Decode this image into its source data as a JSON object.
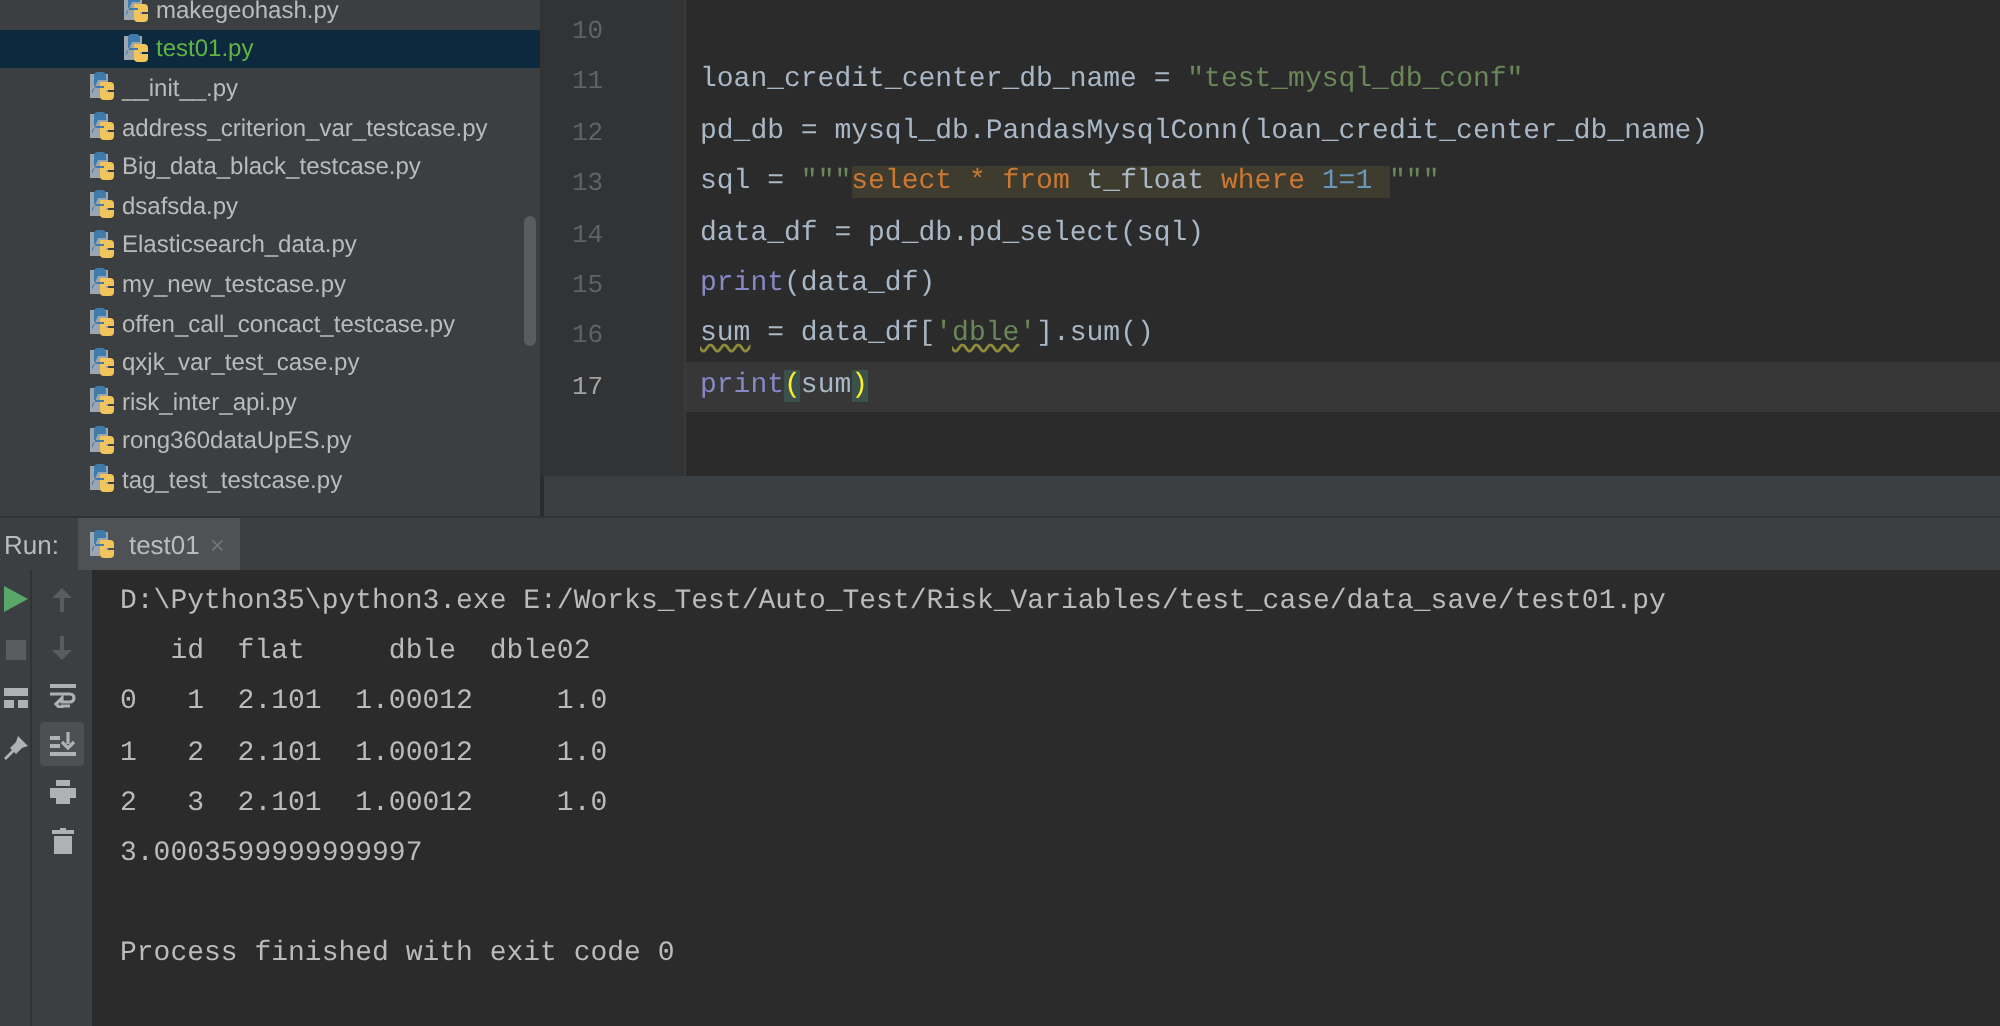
{
  "project_tree": [
    {
      "children": [
        {
          "label": "makegeohash.py",
          "selected": false
        },
        {
          "label": "test01.py",
          "selected": true
        }
      ]
    },
    {
      "label": "__init__.py",
      "selected": false
    },
    {
      "label": "address_criterion_var_testcase.py",
      "selected": false
    },
    {
      "label": "Big_data_black_testcase.py",
      "selected": false
    },
    {
      "label": "dsafsda.py",
      "selected": false
    },
    {
      "label": "Elasticsearch_data.py",
      "selected": false
    },
    {
      "label": "my_new_testcase.py",
      "selected": false
    },
    {
      "label": "offen_call_concact_testcase.py",
      "selected": false
    },
    {
      "label": "qxjk_var_test_case.py",
      "selected": false
    },
    {
      "label": "risk_inter_api.py",
      "selected": false
    },
    {
      "label": "rong360dataUpES.py",
      "selected": false
    },
    {
      "label": "tag_test_testcase.py",
      "selected": false
    }
  ],
  "editor": {
    "lines": [
      {
        "number": "10",
        "current": false
      },
      {
        "number": "11",
        "current": false,
        "tokens": [
          {
            "text": "loan_credit_center_db_name = ",
            "kind": "plain"
          },
          {
            "text": "\"test_mysql_db_conf\"",
            "kind": "string"
          }
        ]
      },
      {
        "number": "12",
        "current": false,
        "tokens": [
          {
            "text": "pd_db = mysql_db.PandasMysqlConn(loan_credit_center_db_name)",
            "kind": "plain"
          }
        ]
      },
      {
        "number": "13",
        "current": false,
        "tokens": [
          {
            "text": "sql = ",
            "kind": "plain"
          },
          {
            "text": "\"\"\"",
            "kind": "string"
          },
          {
            "text": "select * from ",
            "kind": "sql_keyword"
          },
          {
            "text": "t_float ",
            "kind": "sql_plain"
          },
          {
            "text": "where ",
            "kind": "sql_keyword"
          },
          {
            "text": "1=1 ",
            "kind": "sql_number"
          },
          {
            "text": "\"\"\"",
            "kind": "string"
          }
        ]
      },
      {
        "number": "14",
        "current": false,
        "tokens": [
          {
            "text": "data_df = pd_db.pd_select(sql)",
            "kind": "plain"
          }
        ]
      },
      {
        "number": "15",
        "current": false,
        "tokens": [
          {
            "text": "print",
            "kind": "builtin"
          },
          {
            "text": "(data_df)",
            "kind": "plain"
          }
        ]
      },
      {
        "number": "16",
        "current": false,
        "tokens": [
          {
            "text": "sum",
            "kind": "warning"
          },
          {
            "text": " = data_df[",
            "kind": "plain"
          },
          {
            "text": "'",
            "kind": "string"
          },
          {
            "text": "dble",
            "kind": "string_warning"
          },
          {
            "text": "'",
            "kind": "string"
          },
          {
            "text": "].sum()",
            "kind": "plain"
          }
        ]
      },
      {
        "number": "17",
        "current": true,
        "tokens": [
          {
            "text": "print",
            "kind": "builtin"
          },
          {
            "text": "(",
            "kind": "bracket"
          },
          {
            "text": "sum",
            "kind": "plain"
          },
          {
            "text": ")",
            "kind": "bracket"
          }
        ]
      }
    ]
  },
  "run_panel": {
    "label": "Run:",
    "tabs": [
      {
        "label": "test01",
        "close": "×",
        "selected": true
      }
    ],
    "output": [
      "D:\\Python35\\python3.exe E:/Works_Test/Auto_Test/Risk_Variables/test_case/data_save/test01.py",
      "   id  flat     dble  dble02",
      "0   1  2.101  1.00012     1.0",
      "1   2  2.101  1.00012     1.0",
      "2   3  2.101  1.00012     1.0",
      "3.0003599999999997"
    ],
    "exit_message": "Process finished with exit code 0",
    "scroll_to_end": {
      "on": true
    }
  }
}
